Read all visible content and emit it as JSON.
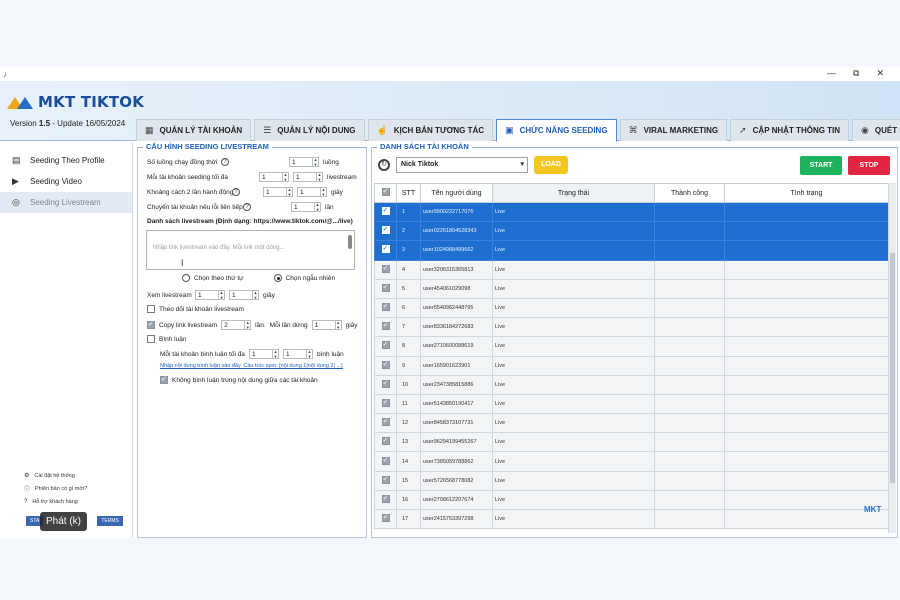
{
  "window": {
    "app_icon": "tiktok-app-icon",
    "controls": [
      "—",
      "⧉",
      "✕"
    ]
  },
  "brand": {
    "name": "MKT TIKTOK",
    "version_label": "Version",
    "version": "1.5",
    "update": "- Update  16/05/2024"
  },
  "tabs": [
    {
      "label": "QUẢN LÝ TÀI KHOẢN",
      "icon": "account-icon"
    },
    {
      "label": "QUẢN LÝ NỘI DUNG",
      "icon": "list-icon"
    },
    {
      "label": "KỊCH BẢN TƯƠNG TÁC",
      "icon": "hand-icon"
    },
    {
      "label": "CHỨC NĂNG SEEDING",
      "icon": "seeding-icon"
    },
    {
      "label": "VIRAL MARKETING",
      "icon": "viral-icon"
    },
    {
      "label": "CẬP NHẬT THÔNG TIN",
      "icon": "update-icon"
    },
    {
      "label": "QUÉT DỮ LIỆU",
      "icon": "scan-icon"
    }
  ],
  "sidebar": {
    "items": [
      {
        "label": "Seeding Theo Profile"
      },
      {
        "label": "Seeding Video"
      },
      {
        "label": "Seeding Livestream"
      }
    ],
    "footer": [
      {
        "label": "Cài đặt hệ thống"
      },
      {
        "label": "Phiên bản có gì mới?"
      },
      {
        "label": "Hỗ trợ khách hàng"
      }
    ],
    "footer_buttons": [
      "STA",
      "TERMS"
    ]
  },
  "tooltip": "Phát (k)",
  "config": {
    "section_title": "CẤU HÌNH SEEDING LIVESTREAM",
    "threads_label": "Số luồng chạy đồng thời",
    "threads_value": "1",
    "threads_unit": "luồng",
    "max_seed_label": "Mỗi tài khoản seeding tối đa",
    "max_seed_from": "1",
    "max_seed_to": "1",
    "max_seed_unit": "livestream",
    "gap_label": "Khoảng cách 2 lần hành động",
    "gap_from": "1",
    "gap_to": "1",
    "gap_unit": "giây",
    "switch_label": "Chuyển tài khoản nếu lỗi liên tiếp",
    "switch_value": "1",
    "switch_unit": "lần",
    "list_label": "Danh sách livestream (Định dạng: https://www.tiktok.com/@.../live)",
    "textarea_placeholder": "Nhập link livestream vào đây. Mỗi link một dòng...",
    "order_sequential": "Chọn theo thứ tự",
    "order_random": "Chọn ngẫu nhiên",
    "watch_label": "Xem livestream",
    "watch_from": "1",
    "watch_to": "1",
    "watch_unit": "giây",
    "follow_label": "Theo dõi tài khoản livestream",
    "copy_label": "Copy link livestream",
    "copy_value": "2",
    "copy_unit": "lần.",
    "copy_each_label": "Mỗi lần dừng",
    "copy_each_value": "1",
    "copy_each_unit": "giây",
    "comment_label": "Bình luận",
    "comment_max_label": "Mỗi tài khoản bình luận tối đa",
    "comment_max_from": "1",
    "comment_max_to": "1",
    "comment_max_unit": "bình luận",
    "comment_link": "Nhập nội dung bình luận vào đây. Cấu trúc spin: {nội dung 1|nội dung 2| ...}",
    "no_dup_label": "Không bình luận trùng nội dung giữa các tài khoản"
  },
  "accounts": {
    "section_title": "DANH SÁCH TÀI KHOẢN",
    "select_value": "Nick Tiktok",
    "load_label": "LOAD",
    "start_label": "START",
    "stop_label": "STOP",
    "columns": [
      "STT",
      "Tên người dùng",
      "Trạng thái",
      "Thành công",
      "Tình trạng"
    ],
    "rows": [
      {
        "stt": "1",
        "user": "user9900222717076",
        "status": "Live",
        "selected": true
      },
      {
        "stt": "2",
        "user": "user02261804528343",
        "status": "Live",
        "selected": true
      },
      {
        "stt": "3",
        "user": "user1024988499662",
        "status": "Live",
        "selected": true
      },
      {
        "stt": "4",
        "user": "user3206315365813",
        "status": "Live",
        "selected": false
      },
      {
        "stt": "5",
        "user": "user454061029098",
        "status": "Live",
        "selected": false
      },
      {
        "stt": "6",
        "user": "user6540982448795",
        "status": "Live",
        "selected": false
      },
      {
        "stt": "7",
        "user": "user8336184272683",
        "status": "Live",
        "selected": false
      },
      {
        "stt": "8",
        "user": "user2710600088619",
        "status": "Live",
        "selected": false
      },
      {
        "stt": "9",
        "user": "user165901623901",
        "status": "Live",
        "selected": false
      },
      {
        "stt": "10",
        "user": "user2347385815886",
        "status": "Live",
        "selected": false
      },
      {
        "stt": "11",
        "user": "user5143850190417",
        "status": "Live",
        "selected": false
      },
      {
        "stt": "12",
        "user": "user8458373107731",
        "status": "Live",
        "selected": false
      },
      {
        "stt": "13",
        "user": "user96294199455267",
        "status": "Live",
        "selected": false
      },
      {
        "stt": "14",
        "user": "user7385059788862",
        "status": "Live",
        "selected": false
      },
      {
        "stt": "15",
        "user": "user5726568778082",
        "status": "Live",
        "selected": false
      },
      {
        "stt": "16",
        "user": "user2708612207674",
        "status": "Live",
        "selected": false
      },
      {
        "stt": "17",
        "user": "user2415753397298",
        "status": "Live",
        "selected": false
      }
    ]
  },
  "watermark": "MKT",
  "colors": {
    "accent": "#1f5fbf",
    "selected_row": "#1f6fd1",
    "start": "#1fb25c",
    "stop": "#e2263f",
    "load": "#f3c622"
  }
}
